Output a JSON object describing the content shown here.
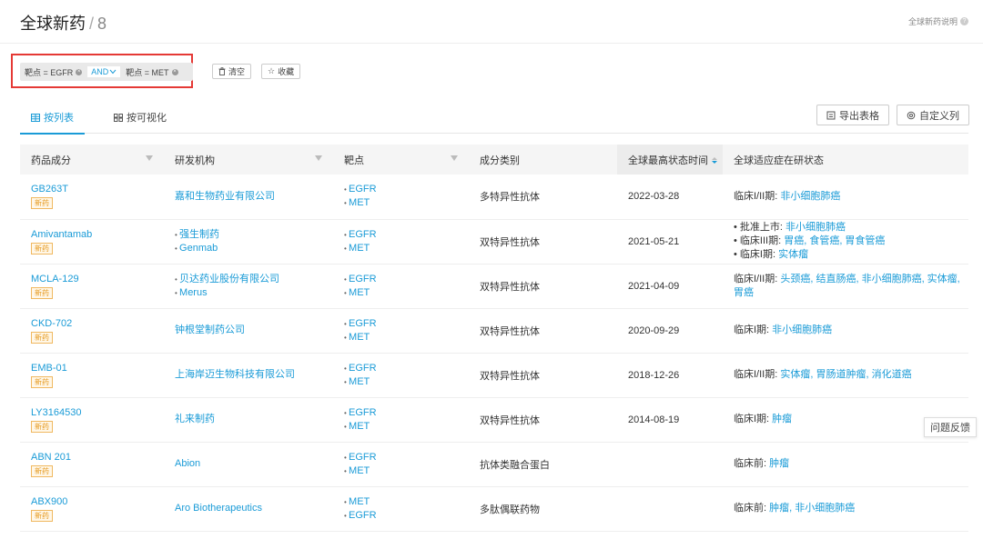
{
  "header": {
    "title": "全球新药",
    "separator": "/",
    "count": "8",
    "help_label": "全球新药说明"
  },
  "filters": {
    "chip1": "靶点 = EGFR",
    "and_label": "AND",
    "chip2": "靶点 = MET"
  },
  "actions": {
    "clear_label": "清空",
    "favorite_label": "收藏"
  },
  "tabs": [
    {
      "label": "按列表"
    },
    {
      "label": "按可视化"
    }
  ],
  "toolbar": {
    "export_label": "导出表格",
    "custom_label": "自定义列"
  },
  "table": {
    "columns": [
      "药品成分",
      "研发机构",
      "靶点",
      "成分类别",
      "全球最高状态时间",
      "全球适应症在研状态"
    ],
    "rows": [
      {
        "drug": "GB263T",
        "tag": "新药",
        "orgs": [
          "嘉和生物药业有限公司"
        ],
        "targets": [
          "EGFR",
          "MET"
        ],
        "category": "多特异性抗体",
        "date": "2022-03-28",
        "status": [
          {
            "prefix": "临床I/II期: ",
            "items": "非小细胞肺癌"
          }
        ]
      },
      {
        "drug": "Amivantamab",
        "tag": "新药",
        "orgs": [
          "强生制药",
          "Genmab"
        ],
        "targets": [
          "EGFR",
          "MET"
        ],
        "category": "双特异性抗体",
        "date": "2021-05-21",
        "status": [
          {
            "prefix": "• 批准上市: ",
            "items": "非小细胞肺癌"
          },
          {
            "prefix": "• 临床III期: ",
            "items": "胃癌, 食管癌, 胃食管癌"
          },
          {
            "prefix": "• 临床I期: ",
            "items": "实体瘤"
          }
        ]
      },
      {
        "drug": "MCLA-129",
        "tag": "新药",
        "orgs": [
          "贝达药业股份有限公司",
          "Merus"
        ],
        "targets": [
          "EGFR",
          "MET"
        ],
        "category": "双特异性抗体",
        "date": "2021-04-09",
        "status": [
          {
            "prefix": "临床I/II期: ",
            "items": "头颈癌, 结直肠癌, 非小细胞肺癌, 实体瘤,"
          },
          {
            "prefix": "",
            "items": "胃癌"
          }
        ]
      },
      {
        "drug": "CKD-702",
        "tag": "新药",
        "orgs": [
          "钟根堂制药公司"
        ],
        "targets": [
          "EGFR",
          "MET"
        ],
        "category": "双特异性抗体",
        "date": "2020-09-29",
        "status": [
          {
            "prefix": "临床I期: ",
            "items": "非小细胞肺癌"
          }
        ]
      },
      {
        "drug": "EMB-01",
        "tag": "新药",
        "orgs": [
          "上海岸迈生物科技有限公司"
        ],
        "targets": [
          "EGFR",
          "MET"
        ],
        "category": "双特异性抗体",
        "date": "2018-12-26",
        "status": [
          {
            "prefix": "临床I/II期: ",
            "items": "实体瘤, 胃肠道肿瘤, 消化道癌"
          }
        ]
      },
      {
        "drug": "LY3164530",
        "tag": "新药",
        "orgs": [
          "礼来制药"
        ],
        "targets": [
          "EGFR",
          "MET"
        ],
        "category": "双特异性抗体",
        "date": "2014-08-19",
        "status": [
          {
            "prefix": "临床I期: ",
            "items": "肿瘤"
          }
        ]
      },
      {
        "drug": "ABN 201",
        "tag": "新药",
        "orgs": [
          "Abion"
        ],
        "targets": [
          "EGFR",
          "MET"
        ],
        "category": "抗体类融合蛋白",
        "date": "",
        "status": [
          {
            "prefix": "临床前: ",
            "items": "肿瘤"
          }
        ]
      },
      {
        "drug": "ABX900",
        "tag": "新药",
        "orgs": [
          "Aro Biotherapeutics"
        ],
        "targets": [
          "MET",
          "EGFR"
        ],
        "category": "多肽偶联药物",
        "date": "",
        "status": [
          {
            "prefix": "临床前: ",
            "items": "肿瘤, 非小细胞肺癌"
          }
        ]
      }
    ]
  },
  "feedback_label": "问题反馈",
  "colors": {
    "accent": "#1a9bd7",
    "highlight_border": "#e53935",
    "new_tag": "#e69a20"
  }
}
